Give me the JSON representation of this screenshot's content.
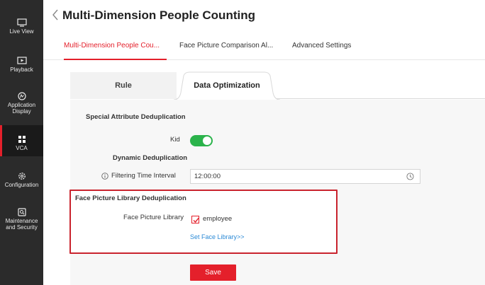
{
  "sidebar": {
    "items": [
      {
        "label": "Live View",
        "icon": "monitor-icon"
      },
      {
        "label": "Playback",
        "icon": "playback-icon"
      },
      {
        "label_line1": "Application",
        "label_line2": "Display",
        "icon": "application-display-icon"
      },
      {
        "label": "VCA",
        "icon": "vca-grid-icon",
        "active": true
      },
      {
        "label": "Configuration",
        "icon": "gear-icon"
      },
      {
        "label_line1": "Maintenance",
        "label_line2": "and Security",
        "icon": "maintenance-icon"
      }
    ]
  },
  "header": {
    "title": "Multi-Dimension People Counting"
  },
  "top_tabs": [
    {
      "label": "Multi-Dimension People Cou...",
      "active": true
    },
    {
      "label": "Face Picture Comparison Al...",
      "active": false
    },
    {
      "label": "Advanced Settings",
      "active": false
    }
  ],
  "sub_tabs": [
    {
      "label": "Rule",
      "active": false
    },
    {
      "label": "Data Optimization",
      "active": true
    }
  ],
  "form": {
    "special_attr_heading": "Special Attribute Deduplication",
    "kid_label": "Kid",
    "kid_enabled": true,
    "dynamic_heading": "Dynamic Deduplication",
    "filter_time_label": "Filtering Time Interval",
    "filter_time_value": "12:00:00",
    "face_lib_heading": "Face Picture Library Deduplication",
    "face_lib_label": "Face Picture Library",
    "face_lib_option": "employee",
    "face_lib_checked": true,
    "set_face_library_link": "Set Face Library>>",
    "save_label": "Save"
  },
  "colors": {
    "accent": "#e4202b",
    "toggle_on": "#2bb34b",
    "link": "#2b8ad6",
    "sidebar_bg": "#2b2b2b",
    "highlight_border": "#c9232d"
  }
}
